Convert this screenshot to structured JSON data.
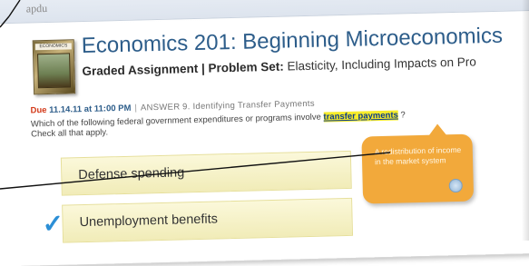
{
  "header": {
    "crumb": "apdu"
  },
  "book": {
    "label": "ECONOMICS"
  },
  "course": {
    "title": "Economics 201: Beginning Microeconomics",
    "assignment_prefix": "Graded Assignment | Problem Set:",
    "assignment_topic": " Elasticity, Including Impacts on Pro"
  },
  "due": {
    "label": "Due",
    "datetime": "11.14.11 at 11:00 PM",
    "separator": "|",
    "answer_label": "ANSWER",
    "question_title": "9. Identifying Transfer Payments"
  },
  "question": {
    "text_before": "Which of the following federal government expenditures or programs involve ",
    "highlight": "transfer payments",
    "text_after": " ?",
    "instruction": "Check all that apply."
  },
  "options": [
    {
      "label": "Defense spending",
      "checked": false
    },
    {
      "label": "Unemployment benefits",
      "checked": true
    }
  ],
  "tooltip": {
    "text": "A redistribution of income in the market system"
  },
  "colors": {
    "title": "#2d5d8a",
    "due": "#d33a1a",
    "highlight": "#f7ec2b",
    "tooltip": "#f2a93b",
    "option_bg": "#f5f1c6",
    "check": "#2c8fd6"
  },
  "icons": {
    "check": "checkmark-icon",
    "tooltip_close": "close-icon"
  }
}
